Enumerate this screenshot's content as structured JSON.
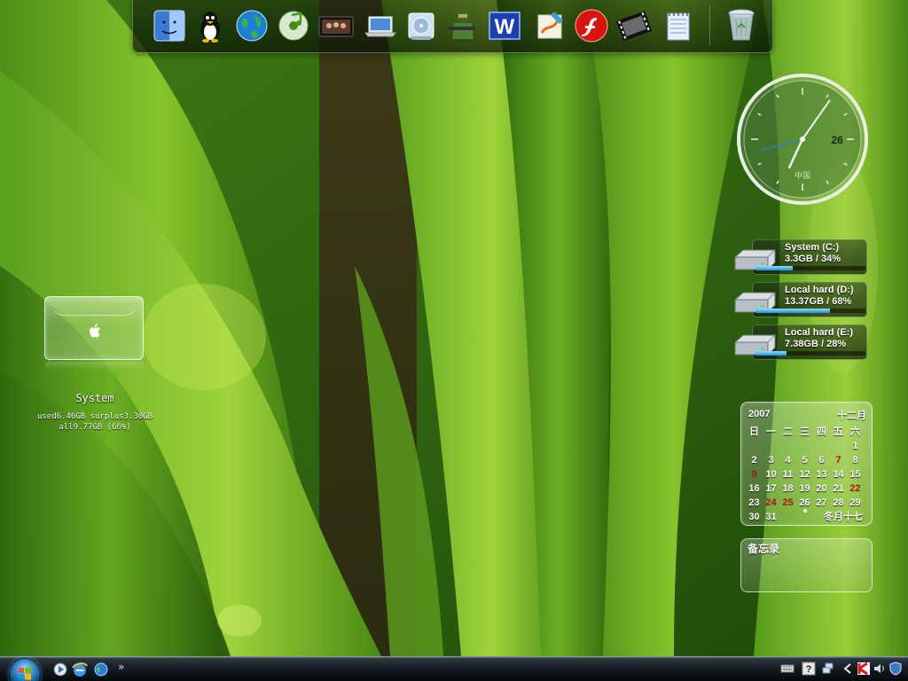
{
  "dock": {
    "items": [
      {
        "name": "finder-icon"
      },
      {
        "name": "penguin-icon"
      },
      {
        "name": "globe-icon"
      },
      {
        "name": "music-disc-icon"
      },
      {
        "name": "media-player-icon"
      },
      {
        "name": "laptop-icon"
      },
      {
        "name": "disk-drive-icon"
      },
      {
        "name": "soldier-game-icon"
      },
      {
        "name": "word-icon"
      },
      {
        "name": "paint-palette-icon"
      },
      {
        "name": "flash-icon"
      },
      {
        "name": "movie-film-icon"
      },
      {
        "name": "notepad-icon"
      },
      {
        "name": "recycle-bin-icon"
      }
    ]
  },
  "clock": {
    "day": "26",
    "location": "中国",
    "hour_hand_deg": 205,
    "minute_hand_deg": 35,
    "second_hand_deg": 255
  },
  "drives": [
    {
      "name": "System (C:)",
      "usage": "3.3GB / 34%",
      "percent": 34
    },
    {
      "name": "Local hard (D:)",
      "usage": "13.37GB / 68%",
      "percent": 68
    },
    {
      "name": "Local hard (E:)",
      "usage": "7.38GB / 28%",
      "percent": 28
    }
  ],
  "calendar": {
    "year": "2007",
    "month": "十二月",
    "weekdays": [
      "日",
      "一",
      "二",
      "三",
      "四",
      "五",
      "六"
    ],
    "weeks": [
      [
        "",
        "",
        "",
        "",
        "",
        "",
        "1"
      ],
      [
        "2",
        "3",
        "4",
        "5",
        "6",
        "7",
        "8"
      ],
      [
        "9",
        "10",
        "11",
        "12",
        "13",
        "14",
        "15"
      ],
      [
        "16",
        "17",
        "18",
        "19",
        "20",
        "21",
        "22"
      ],
      [
        "23",
        "24",
        "25",
        "26",
        "27",
        "28",
        "29"
      ],
      [
        "30",
        "31",
        "",
        "",
        "",
        "",
        ""
      ]
    ],
    "highlighted": [
      "7",
      "9",
      "22",
      "24",
      "25"
    ],
    "today": "26",
    "lunar": "冬月十七"
  },
  "memo": {
    "title": "备忘录"
  },
  "system_widget": {
    "name": "System",
    "used_line": "used6.46GB surplus3.30GB",
    "all_line": "all9.77GB (66%)",
    "logo": "apple-logo-icon"
  },
  "taskbar": {
    "quick_launch": [
      "show-desktop-icon",
      "internet-explorer-icon",
      "media-globe-icon"
    ],
    "overflow": "»",
    "tray": [
      "keyboard-icon",
      "help-icon",
      "network-icon",
      "arrow-left-icon",
      "antivirus-icon",
      "volume-icon",
      "shield-icon"
    ]
  },
  "colors": {
    "wallpaper_base": "#3f7a12",
    "drive_bar": "#1e8fd6",
    "calendar_highlight": "#b01010"
  }
}
